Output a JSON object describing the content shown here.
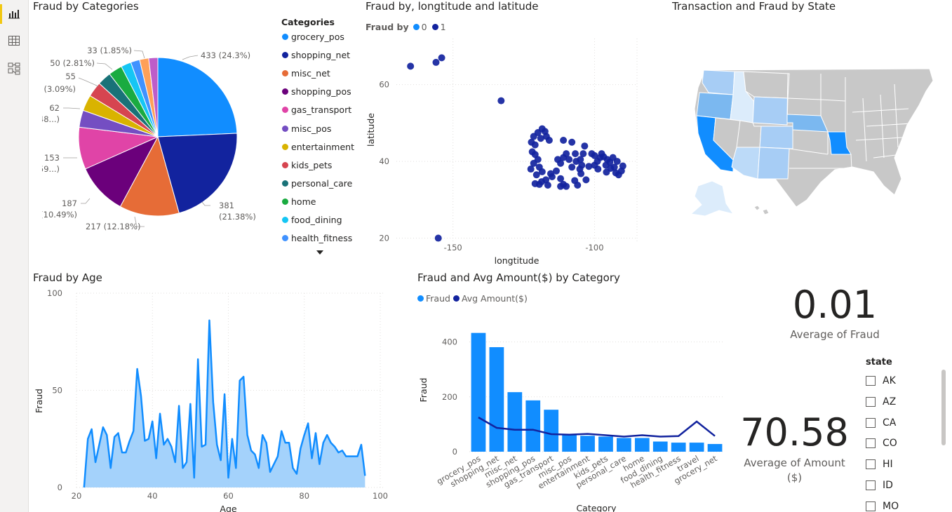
{
  "rail": {
    "icons": [
      "report-view-icon",
      "data-view-icon",
      "model-view-icon"
    ]
  },
  "titles": {
    "categories": "Fraud by Categories",
    "geo": "Fraud by, longtitude and latitude",
    "map": "Transaction and Fraud by State",
    "age": "Fraud by Age",
    "combo": "Fraud and Avg Amount($) by Category"
  },
  "pie": {
    "legend_title": "Categories",
    "slices": [
      {
        "name": "grocery_pos",
        "value": 433,
        "color": "#118DFF"
      },
      {
        "name": "shopping_net",
        "value": 381,
        "color": "#12239E"
      },
      {
        "name": "misc_net",
        "value": 217,
        "color": "#E66C37"
      },
      {
        "name": "shopping_pos",
        "value": 187,
        "color": "#6B007B"
      },
      {
        "name": "gas_transport",
        "value": 153,
        "color": "#E044A7"
      },
      {
        "name": "misc_pos",
        "value": 62,
        "color": "#744EC2"
      },
      {
        "name": "entertainment",
        "value": 58,
        "color": "#D9B300"
      },
      {
        "name": "kids_pets",
        "value": 55,
        "color": "#D64550"
      },
      {
        "name": "personal_care",
        "value": 50,
        "color": "#197278"
      },
      {
        "name": "home",
        "value": 50,
        "color": "#1AAB40"
      },
      {
        "name": "food_dining",
        "value": 37,
        "color": "#15C6F4"
      },
      {
        "name": "health_fitness",
        "value": 33,
        "color": "#4092FF"
      },
      {
        "name": "travel",
        "value": 33,
        "color": "#FFA058"
      },
      {
        "name": "grocery_net",
        "value": 33,
        "color": "#BE5DC9"
      }
    ],
    "labels": {
      "l433": "433 (24.3%)",
      "l381a": "381",
      "l381b": "(21.38%)",
      "l217": "217 (12.18%)",
      "l187a": "187",
      "l187b": "(10.49%)",
      "l153a": "153",
      "l153b": "(8.59...)",
      "l62a": "62",
      "l62b": "(3.48...)",
      "l55a": "55",
      "l55b": "(3.09%)",
      "l50": "50 (2.81%)",
      "l33": "33 (1.85%)"
    }
  },
  "geo": {
    "legend_title": "Fraud by",
    "legend": [
      {
        "name": "0",
        "color": "#118DFF"
      },
      {
        "name": "1",
        "color": "#12239E"
      }
    ],
    "xlabel": "longtitude",
    "ylabel": "latitude",
    "xticks": [
      "-150",
      "-100"
    ],
    "yticks": [
      "60",
      "40",
      "20"
    ]
  },
  "age": {
    "ylabel": "Fraud",
    "xlabel": "Age",
    "yticks": [
      "100",
      "50",
      "0"
    ],
    "xticks": [
      "20",
      "40",
      "60",
      "80",
      "100"
    ]
  },
  "combo": {
    "legend": [
      {
        "name": "Fraud",
        "color": "#118DFF"
      },
      {
        "name": "Avg Amount($)",
        "color": "#12239E"
      }
    ],
    "ylabel": "Fraud",
    "xlabel": "Category",
    "yticks": [
      "400",
      "200",
      "0"
    ]
  },
  "kpi": {
    "fraud_value": "0.01",
    "fraud_label": "Average of Fraud",
    "amount_value": "70.58",
    "amount_label_1": "Average of Amount",
    "amount_label_2": "($)"
  },
  "slicer": {
    "title": "state",
    "items": [
      "AK",
      "AZ",
      "CA",
      "CO",
      "HI",
      "ID",
      "MO"
    ]
  },
  "chart_data": [
    {
      "type": "pie",
      "title": "Fraud by Categories",
      "categories": [
        "grocery_pos",
        "shopping_net",
        "misc_net",
        "shopping_pos",
        "gas_transport",
        "misc_pos",
        "entertainment",
        "kids_pets",
        "personal_care",
        "home",
        "food_dining",
        "health_fitness",
        "travel",
        "grocery_net"
      ],
      "values": [
        433,
        381,
        217,
        187,
        153,
        62,
        58,
        55,
        50,
        50,
        37,
        33,
        33,
        33
      ]
    },
    {
      "type": "scatter",
      "title": "Fraud by, longtitude and latitude",
      "xlabel": "longtitude",
      "ylabel": "latitude",
      "xlim": [
        -170,
        -85
      ],
      "ylim": [
        19,
        72
      ],
      "series": [
        {
          "name": "1",
          "points": [
            [
              -165,
              64.8
            ],
            [
              -156,
              65.8
            ],
            [
              -154,
              67
            ],
            [
              -133,
              55.8
            ],
            [
              -155.2,
              20
            ],
            [
              -121.5,
              46.5
            ],
            [
              -120,
              47.5
            ],
            [
              -118.5,
              48.5
            ],
            [
              -117.5,
              47.8
            ],
            [
              -119,
              46
            ],
            [
              -122.3,
              45
            ],
            [
              -121,
              44.3
            ],
            [
              -117,
              46.5
            ],
            [
              -116,
              45.5
            ],
            [
              -122,
              42.5
            ],
            [
              -121,
              41.8
            ],
            [
              -120,
              40.5
            ],
            [
              -121.5,
              39.5
            ],
            [
              -119.5,
              38.5
            ],
            [
              -118.5,
              37.3
            ],
            [
              -117.2,
              35.2
            ],
            [
              -118.7,
              34.7
            ],
            [
              -119.5,
              34
            ],
            [
              -121,
              34.2
            ],
            [
              -115,
              36
            ],
            [
              -112,
              39.5
            ],
            [
              -111,
              41
            ],
            [
              -110,
              42
            ],
            [
              -108,
              38.5
            ],
            [
              -106.5,
              40
            ],
            [
              -105,
              40.5
            ],
            [
              -104.5,
              39
            ],
            [
              -105.2,
              38
            ],
            [
              -106.8,
              42
            ],
            [
              -104.8,
              36.8
            ],
            [
              -107,
              35
            ],
            [
              -106,
              33.8
            ],
            [
              -103,
              35.2
            ],
            [
              -112,
              35.5
            ],
            [
              -111,
              34
            ],
            [
              -112,
              33.5
            ],
            [
              -113.5,
              37.5
            ],
            [
              -110,
              33.5
            ],
            [
              -111,
              45.5
            ],
            [
              -108,
              45
            ],
            [
              -104,
              42
            ],
            [
              -103.5,
              44
            ],
            [
              -101,
              42
            ],
            [
              -100,
              41.5
            ],
            [
              -98,
              41
            ],
            [
              -97.5,
              42
            ],
            [
              -96.8,
              41.2
            ],
            [
              -95.5,
              40.5
            ],
            [
              -96,
              39
            ],
            [
              -94.6,
              39.8
            ],
            [
              -94.3,
              38.2
            ],
            [
              -93,
              38.5
            ],
            [
              -92.5,
              37
            ],
            [
              -90,
              38.8
            ],
            [
              -91.5,
              36.5
            ],
            [
              -98.8,
              38
            ],
            [
              -95.8,
              37.2
            ],
            [
              -100,
              39
            ],
            [
              -122.5,
              38
            ],
            [
              -120.5,
              36.5
            ],
            [
              -116.5,
              33.8
            ],
            [
              -115.5,
              36.8
            ],
            [
              -113,
              40.5
            ],
            [
              -109,
              40.5
            ],
            [
              -102,
              38.7
            ],
            [
              -99,
              40
            ],
            [
              -93.5,
              41
            ],
            [
              -92,
              40
            ],
            [
              -90.5,
              37.5
            ]
          ]
        },
        {
          "name": "0",
          "points": []
        }
      ]
    },
    {
      "type": "area",
      "title": "Fraud by Age",
      "xlabel": "Age",
      "ylabel": "Fraud",
      "xlim": [
        20,
        100
      ],
      "ylim": [
        0,
        100
      ],
      "x": [
        22,
        23,
        24,
        25,
        26,
        27,
        28,
        29,
        30,
        31,
        32,
        33,
        34,
        35,
        36,
        37,
        38,
        39,
        40,
        41,
        42,
        43,
        44,
        45,
        46,
        47,
        48,
        49,
        50,
        51,
        52,
        53,
        54,
        55,
        56,
        57,
        58,
        59,
        60,
        61,
        62,
        63,
        64,
        65,
        66,
        67,
        68,
        69,
        70,
        71,
        72,
        73,
        74,
        75,
        76,
        77,
        78,
        79,
        80,
        81,
        82,
        83,
        84,
        85,
        86,
        87,
        88,
        89,
        90,
        91,
        92,
        93,
        94,
        95,
        96
      ],
      "values": [
        0,
        25,
        30,
        13,
        22,
        31,
        27,
        10,
        26,
        28,
        18,
        18,
        24,
        29,
        61,
        47,
        24,
        25,
        34,
        15,
        38,
        22,
        25,
        21,
        13,
        42,
        10,
        13,
        43,
        5,
        66,
        21,
        22,
        86,
        44,
        22,
        14,
        48,
        5,
        25,
        10,
        55,
        57,
        27,
        19,
        17,
        10,
        27,
        23,
        8,
        12,
        16,
        29,
        23,
        23,
        10,
        7,
        20,
        27,
        33,
        15,
        28,
        12,
        23,
        27,
        23,
        21,
        18,
        19,
        16,
        16,
        16,
        16,
        22,
        6
      ]
    },
    {
      "type": "bar",
      "title": "Fraud and Avg Amount($) by Category",
      "xlabel": "Category",
      "ylabel": "Fraud",
      "categories": [
        "grocery_pos",
        "shopping_net",
        "misc_net",
        "shopping_pos",
        "gas_transport",
        "misc_pos",
        "entertainment",
        "kids_pets",
        "personal_care",
        "home",
        "food_dining",
        "health_fitness",
        "travel",
        "grocery_net"
      ],
      "ylim": [
        0,
        450
      ],
      "series": [
        {
          "name": "Fraud",
          "values": [
            433,
            381,
            217,
            187,
            153,
            62,
            58,
            55,
            50,
            50,
            37,
            33,
            33,
            28
          ]
        },
        {
          "name": "Avg Amount($)",
          "values": [
            125,
            87,
            80,
            80,
            64,
            62,
            65,
            60,
            55,
            60,
            55,
            57,
            110,
            57
          ]
        }
      ]
    }
  ]
}
